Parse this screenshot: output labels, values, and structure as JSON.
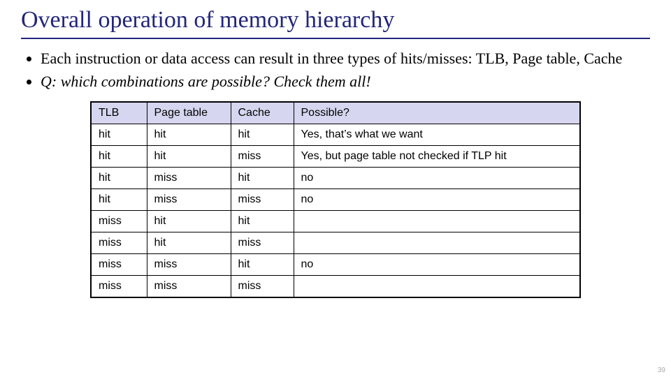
{
  "title": "Overall operation of memory hierarchy",
  "bullets": [
    "Each instruction or data access can result in three types of hits/misses: TLB, Page table, Cache",
    "Q: which combinations are possible? Check them all!"
  ],
  "table": {
    "headers": [
      "TLB",
      "Page table",
      "Cache",
      "Possible?"
    ],
    "rows": [
      [
        "hit",
        "hit",
        "hit",
        "Yes, that’s what we want"
      ],
      [
        "hit",
        "hit",
        "miss",
        "Yes, but page table not checked if TLP hit"
      ],
      [
        "hit",
        "miss",
        "hit",
        "no"
      ],
      [
        "hit",
        "miss",
        "miss",
        "no"
      ],
      [
        "miss",
        "hit",
        "hit",
        ""
      ],
      [
        "miss",
        "hit",
        "miss",
        ""
      ],
      [
        "miss",
        "miss",
        "hit",
        "no"
      ],
      [
        "miss",
        "miss",
        "miss",
        ""
      ]
    ]
  },
  "page_number": "39"
}
